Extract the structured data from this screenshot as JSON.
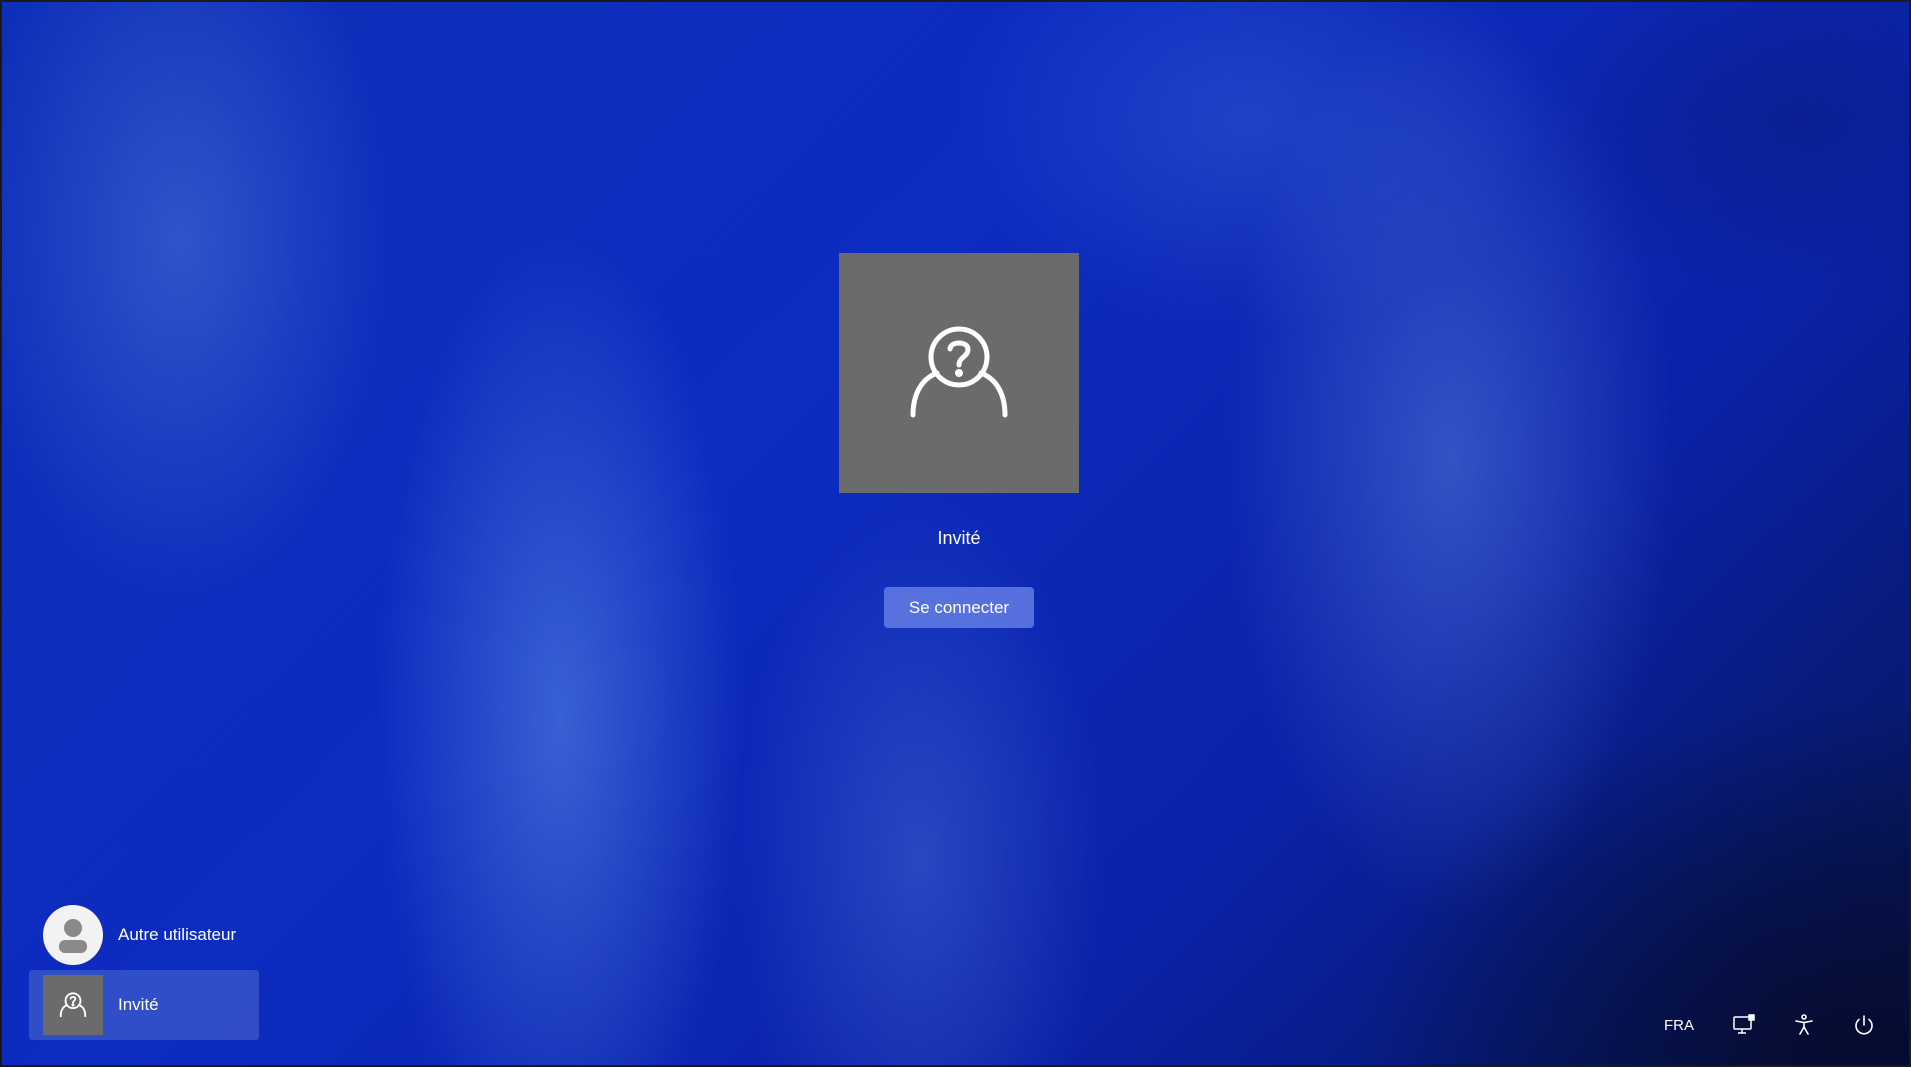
{
  "selected_user": {
    "name": "Invité",
    "avatar_icon": "guest-user-icon"
  },
  "signin": {
    "label": "Se connecter"
  },
  "user_list": [
    {
      "name": "Autre utilisateur",
      "icon": "default-user-icon"
    },
    {
      "name": "Invité",
      "icon": "guest-user-icon"
    }
  ],
  "tray": {
    "language": "FRA",
    "icons": [
      "network-icon",
      "accessibility-icon",
      "power-icon"
    ]
  },
  "colors": {
    "avatar_bg": "#6b6b6b",
    "background_accent": "#0e2fb8"
  }
}
